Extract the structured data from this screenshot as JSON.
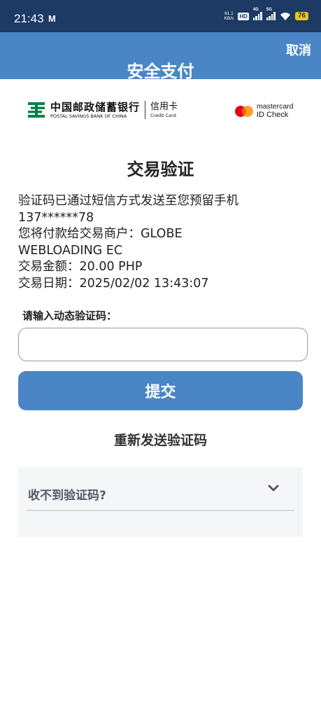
{
  "status_bar": {
    "time": "21:43",
    "mail_icon_label": "M",
    "net_speed_value": "61.1",
    "net_speed_unit": "KB/s",
    "hd_label": "HD",
    "signal1_label": "4G",
    "signal2_label": "5G",
    "battery": "76",
    "bg_color": "#1c3a63"
  },
  "header": {
    "title": "安全支付",
    "cancel": "取消",
    "bg_color": "#4a86c5"
  },
  "logos": {
    "bank_cn": "中国邮政储蓄银行",
    "bank_en": "POSTAL SAVINGS BANK OF CHINA",
    "card_cn": "信用卡",
    "card_en": "Credit Card",
    "mc_brand": "mastercard",
    "mc_id_check": "ID Check"
  },
  "main": {
    "title": "交易验证",
    "info_lines": [
      "验证码已通过短信方式发送至您预留手机",
      "137******78",
      "您将付款给交易商户：GLOBE",
      "WEBLOADING EC",
      "交易金额：20.00 PHP",
      "交易日期：2025/02/02 13:43:07"
    ],
    "otp_label": "请输入动态验证码：",
    "otp_value": "",
    "submit": "提交",
    "resend": "重新发送验证码",
    "faq_question": "收不到验证码?"
  },
  "colors": {
    "accent": "#4a86c5",
    "mc_red": "#eb001b",
    "mc_orange": "#f79e1b",
    "psbc_green": "#00804a"
  },
  "icons": {
    "mail": "gmail-icon",
    "wifi": "wifi-icon",
    "chevron": "chevron-down-icon",
    "bank_logo": "psbc-logo-icon"
  }
}
